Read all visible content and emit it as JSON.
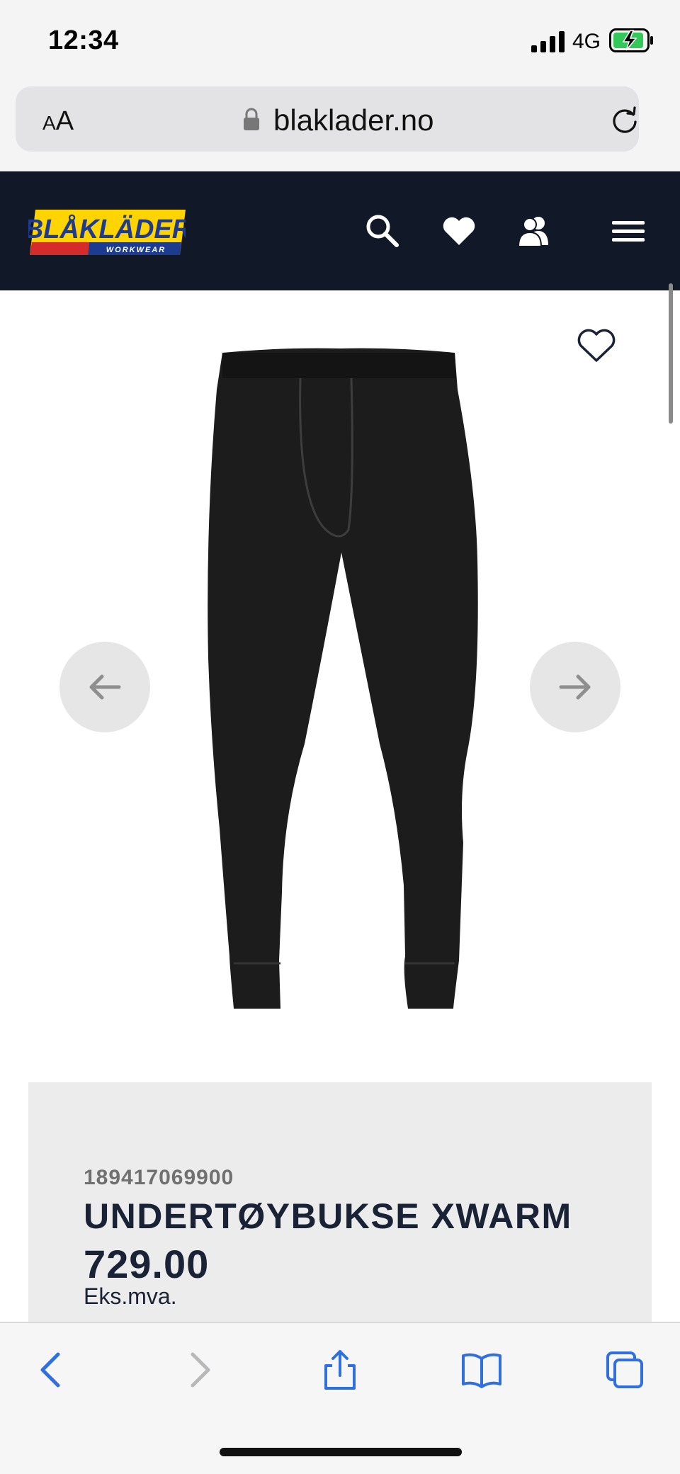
{
  "status_bar": {
    "time": "12:34",
    "network": "4G",
    "battery_color": "#34c759"
  },
  "browser": {
    "text_size_label": "AA",
    "domain": "blaklader.no"
  },
  "header": {
    "brand": "BLÅKLÄDER",
    "brand_sub": "WORKWEAR",
    "bg_color": "#111827"
  },
  "product": {
    "sku": "189417069900",
    "title": "UNDERTØYBUKSE XWARM",
    "price": "729.00",
    "vat_note": "Eks.mva."
  },
  "icons": {
    "search": "search-icon",
    "wishlist": "heart-icon",
    "account": "users-icon",
    "menu": "menu-icon",
    "favorite": "heart-outline-icon",
    "prev": "arrow-left-icon",
    "next": "arrow-right-icon"
  }
}
